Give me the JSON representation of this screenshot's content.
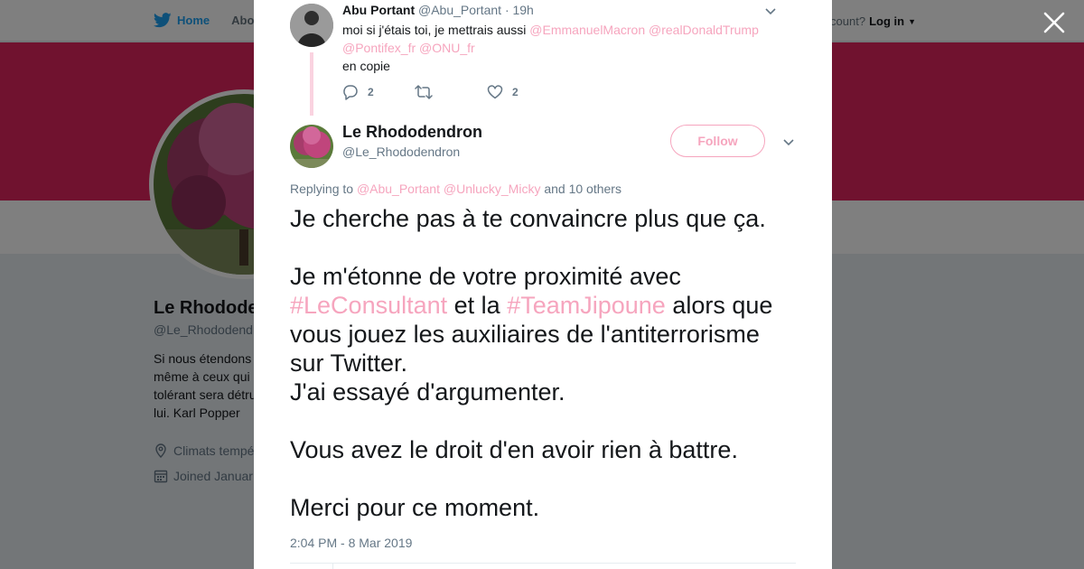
{
  "background": {
    "nav": {
      "home_label": "Home",
      "about_label": "Abo",
      "account_prompt": "ccount?",
      "login_label": "Log in"
    },
    "profile": {
      "name": "Le Rhodode",
      "handle": "@Le_Rhododendr",
      "bio_lines": [
        "Si nous étendons",
        "même à ceux qui",
        "tolérant sera détru",
        "lui. Karl Popper"
      ],
      "location": "Climats tempé",
      "joined": "Joined Januar"
    },
    "colors": {
      "banner": "#e0245e",
      "accent": "#f6a5be",
      "twitter_blue": "#1da1f2"
    }
  },
  "modal": {
    "parent_tweet": {
      "name": "Abu Portant",
      "handle": "@Abu_Portant",
      "time": "· 19h",
      "text_before": "moi si j'étais toi, je mettrais aussi ",
      "mentions": [
        "@EmmanuelMacron",
        "@realDonaldTrump",
        "@Pontifex_fr",
        "@ONU_fr"
      ],
      "text_after": "en copie",
      "reply_count": "2",
      "retweet_count": "",
      "like_count": "2"
    },
    "main_tweet": {
      "name": "Le Rhododendron",
      "handle": "@Le_Rhododendron",
      "follow_label": "Follow",
      "replying_prefix": "Replying to",
      "replying_mentions": [
        "@Abu_Portant",
        "@Unlucky_Micky"
      ],
      "replying_suffix": "and 10 others",
      "text": {
        "p1": "Je cherche pas à te convaincre plus que ça.",
        "p2_l1": "Je m'étonne de votre proximité avec",
        "hashtag1": "#LeConsultant",
        "p2_mid": " et la ",
        "hashtag2": "#TeamJipoune",
        "p2_l2_end": " alors que",
        "p2_l3": "vous jouez les auxiliaires de l'antiterrorisme",
        "p2_l4": "sur Twitter.",
        "p2_l5": "J'ai essayé d'argumenter.",
        "p3": "Vous avez le droit d'en avoir rien à battre.",
        "p4": "Merci pour ce moment."
      },
      "timestamp": "2:04 PM - 8 Mar 2019"
    }
  }
}
